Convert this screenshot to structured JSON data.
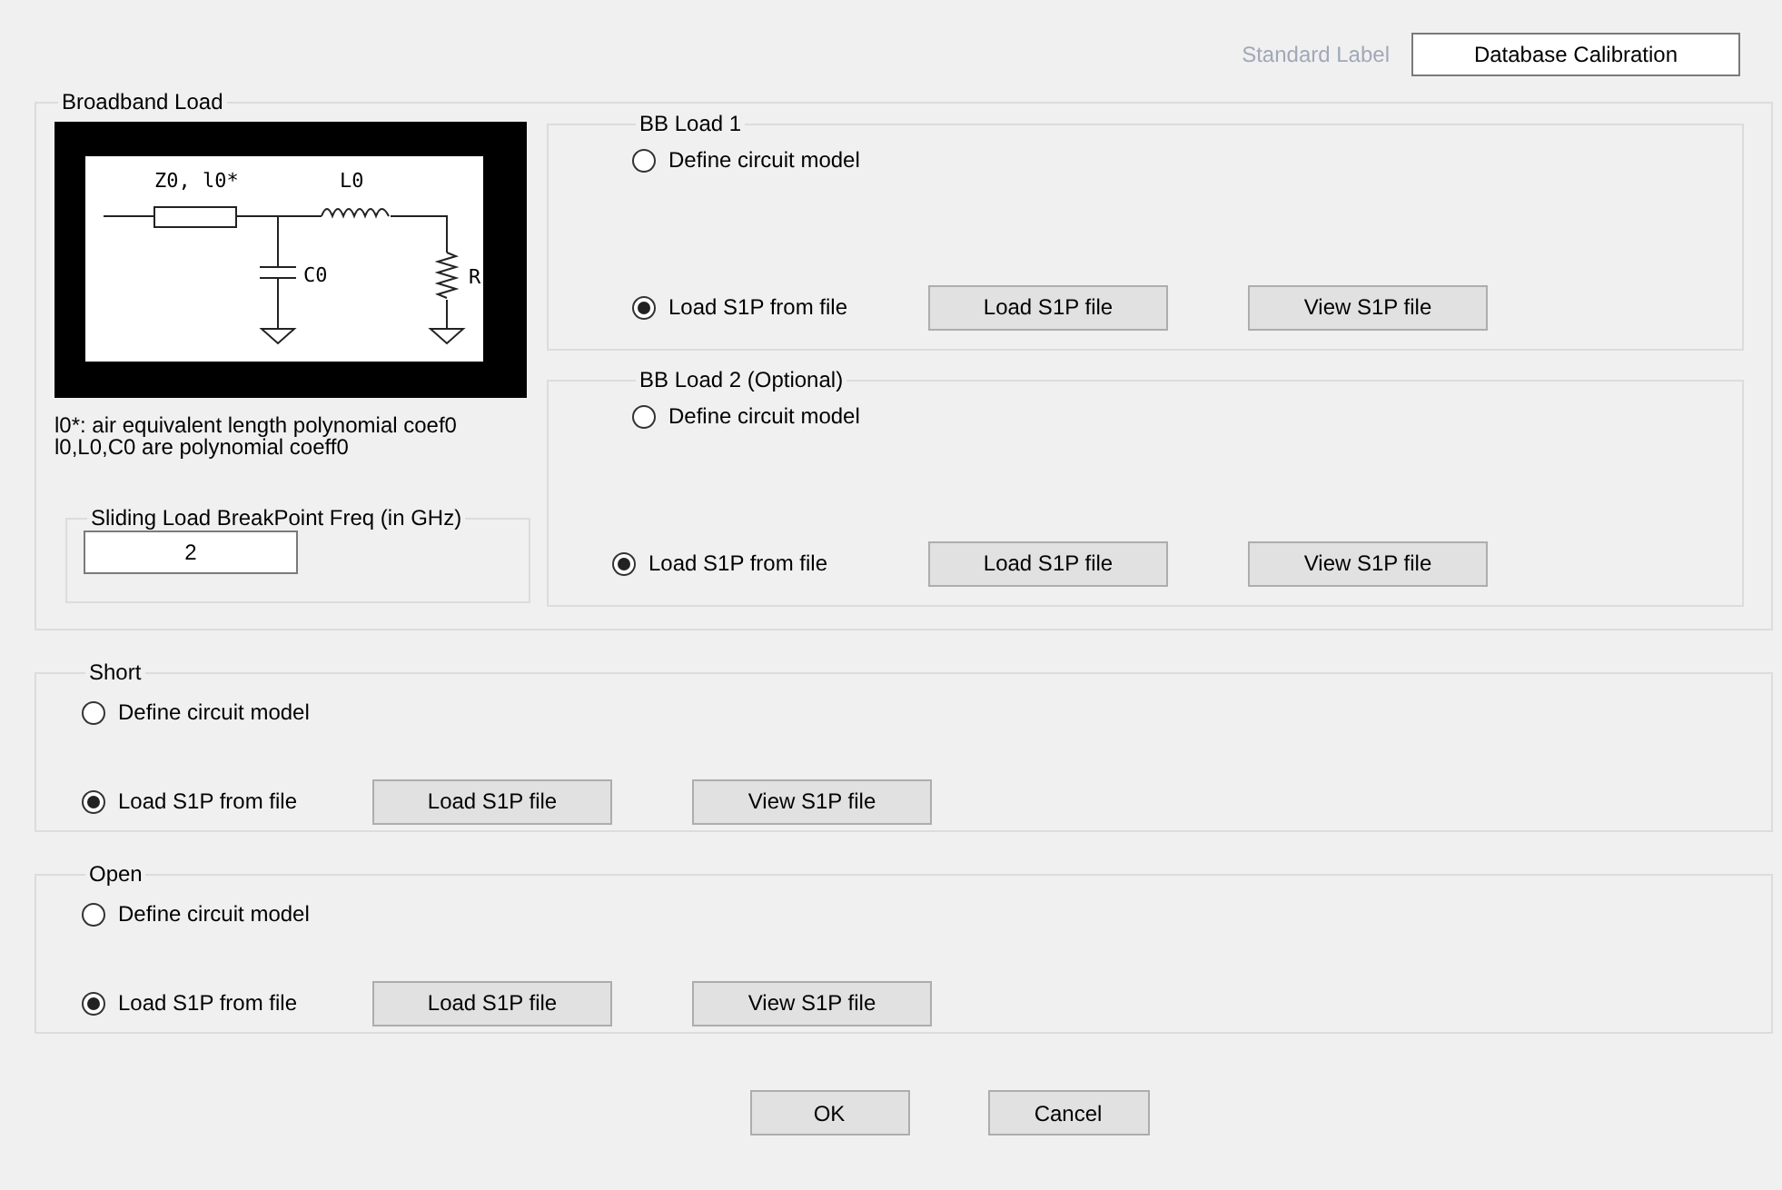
{
  "standard_label": {
    "label": "Standard Label",
    "value": "Database Calibration"
  },
  "broadband_load": {
    "title": "Broadband Load",
    "diagram": {
      "labels": [
        "Z0, l0*",
        "L0",
        "C0",
        "R"
      ]
    },
    "notes": [
      "l0*: air equivalent length polynomial coef0",
      "l0,L0,C0 are polynomial coeff0"
    ],
    "breakpoint": {
      "title": "Sliding Load BreakPoint Freq (in GHz)",
      "value": "2"
    },
    "loads": [
      {
        "title": "BB Load 1",
        "options": [
          {
            "label": "Define circuit model",
            "selected": false
          },
          {
            "label": "Load S1P from file",
            "selected": true
          }
        ],
        "buttons": [
          "Load S1P file",
          "View S1P file"
        ]
      },
      {
        "title": "BB Load 2 (Optional)",
        "options": [
          {
            "label": "Define circuit model",
            "selected": false
          },
          {
            "label": "Load S1P from file",
            "selected": true
          }
        ],
        "buttons": [
          "Load S1P file",
          "View S1P file"
        ]
      }
    ]
  },
  "standards": [
    {
      "title": "Short",
      "options": [
        {
          "label": "Define circuit model",
          "selected": false
        },
        {
          "label": "Load S1P from file",
          "selected": true
        }
      ],
      "buttons": [
        "Load S1P file",
        "View S1P file"
      ]
    },
    {
      "title": "Open",
      "options": [
        {
          "label": "Define circuit model",
          "selected": false
        },
        {
          "label": "Load S1P from file",
          "selected": true
        }
      ],
      "buttons": [
        "Load S1P file",
        "View S1P file"
      ]
    }
  ],
  "buttons": [
    "OK",
    "Cancel"
  ]
}
